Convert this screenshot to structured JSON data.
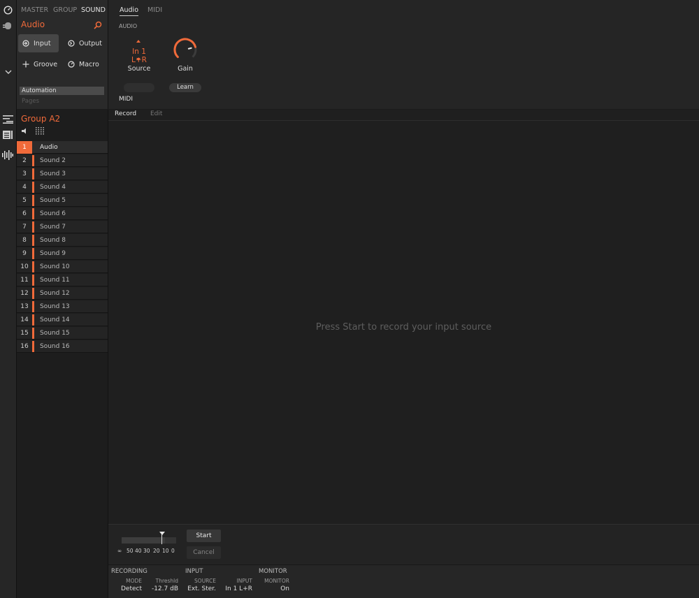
{
  "scope_tabs": [
    "MASTER",
    "GROUP",
    "SOUND"
  ],
  "panel": {
    "title": "Audio",
    "nav": [
      {
        "label": "Input",
        "icon": "input-icon",
        "active": true
      },
      {
        "label": "Output",
        "icon": "output-icon",
        "active": false
      },
      {
        "label": "Groove",
        "icon": "groove-icon",
        "active": false
      },
      {
        "label": "Macro",
        "icon": "macro-icon",
        "active": false
      }
    ],
    "automation": "Automation",
    "pages": "Pages"
  },
  "params": {
    "tabs": [
      "Audio",
      "MIDI"
    ],
    "section": "AUDIO",
    "source_value": "In 1 L+R",
    "source_label": "Source",
    "gain_label": "Gain",
    "gain_level": 0.78,
    "midi_label": "MIDI",
    "learn_label": "Learn"
  },
  "group": {
    "title": "Group A2",
    "sounds": [
      {
        "num": "1",
        "name": "Audio"
      },
      {
        "num": "2",
        "name": "Sound 2"
      },
      {
        "num": "3",
        "name": "Sound 3"
      },
      {
        "num": "4",
        "name": "Sound 4"
      },
      {
        "num": "5",
        "name": "Sound 5"
      },
      {
        "num": "6",
        "name": "Sound 6"
      },
      {
        "num": "7",
        "name": "Sound 7"
      },
      {
        "num": "8",
        "name": "Sound 8"
      },
      {
        "num": "9",
        "name": "Sound 9"
      },
      {
        "num": "10",
        "name": "Sound 10"
      },
      {
        "num": "11",
        "name": "Sound 11"
      },
      {
        "num": "12",
        "name": "Sound 12"
      },
      {
        "num": "13",
        "name": "Sound 13"
      },
      {
        "num": "14",
        "name": "Sound 14"
      },
      {
        "num": "15",
        "name": "Sound 15"
      },
      {
        "num": "16",
        "name": "Sound 16"
      }
    ]
  },
  "main": {
    "tabs": [
      "Record",
      "Edit"
    ],
    "empty_message": "Press Start to record your input source"
  },
  "meter": {
    "ticks": [
      "∞",
      "50",
      "40",
      "30",
      "20",
      "10",
      "0"
    ],
    "threshold_db": -12.7
  },
  "controls": {
    "start": "Start",
    "cancel": "Cancel"
  },
  "info": {
    "recording": {
      "head": "RECORDING",
      "mode_label": "MODE",
      "mode": "Detect",
      "thresh_label": "Threshld",
      "thresh": "-12.7 dB"
    },
    "input": {
      "head": "INPUT",
      "source_label": "SOURCE",
      "source": "Ext. Ster.",
      "input_label": "INPUT",
      "input": "In 1 L+R"
    },
    "monitor": {
      "head": "MONITOR",
      "monitor_label": "MONITOR",
      "monitor": "On"
    }
  },
  "colors": {
    "accent": "#f06a3a",
    "bg": "#1f1f1f"
  }
}
